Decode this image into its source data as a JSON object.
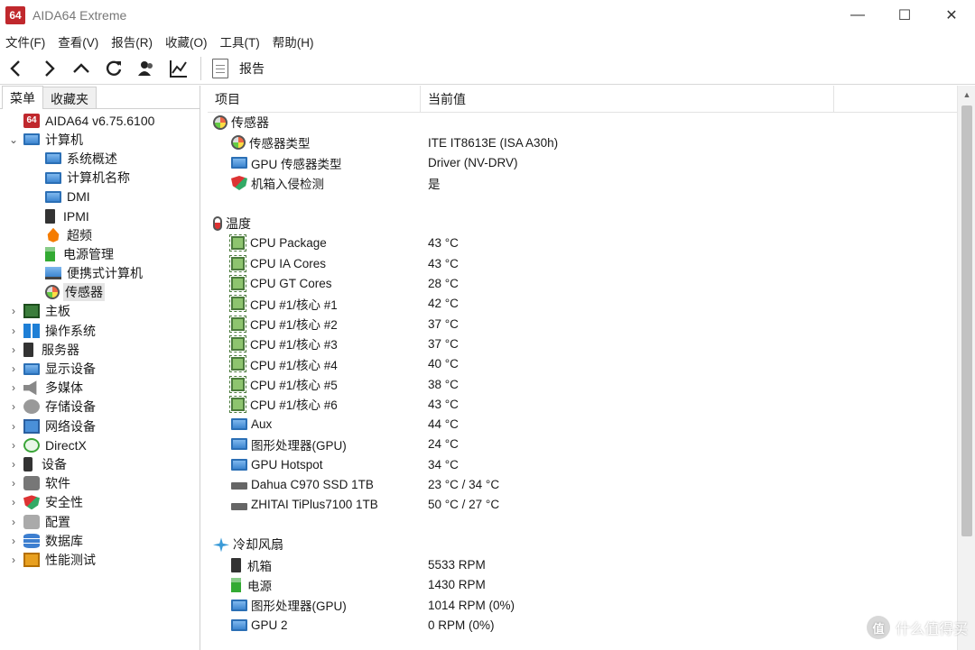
{
  "window": {
    "logo_text": "64",
    "title": "AIDA64 Extreme",
    "controls": {
      "minimize": "—",
      "maximize": "☐",
      "close": "✕"
    }
  },
  "menu": [
    "文件(F)",
    "查看(V)",
    "报告(R)",
    "收藏(O)",
    "工具(T)",
    "帮助(H)"
  ],
  "toolbar": {
    "report_label": "报告"
  },
  "left_panel": {
    "tabs": [
      "菜单",
      "收藏夹"
    ],
    "tree": [
      {
        "label": "AIDA64 v6.75.6100",
        "icon": "aida64-logo-icon",
        "level": 0,
        "chevron": ""
      },
      {
        "label": "计算机",
        "icon": "monitor-icon",
        "level": 0,
        "chevron": "⌄"
      },
      {
        "label": "系统概述",
        "icon": "monitor-icon",
        "level": 1,
        "chevron": ""
      },
      {
        "label": "计算机名称",
        "icon": "monitor-icon",
        "level": 1,
        "chevron": ""
      },
      {
        "label": "DMI",
        "icon": "monitor-icon",
        "level": 1,
        "chevron": ""
      },
      {
        "label": "IPMI",
        "icon": "tower-icon",
        "level": 1,
        "chevron": ""
      },
      {
        "label": "超频",
        "icon": "fire-icon",
        "level": 1,
        "chevron": ""
      },
      {
        "label": "电源管理",
        "icon": "power-icon",
        "level": 1,
        "chevron": ""
      },
      {
        "label": "便携式计算机",
        "icon": "laptop-icon",
        "level": 1,
        "chevron": ""
      },
      {
        "label": "传感器",
        "icon": "gauge-icon",
        "level": 1,
        "chevron": "",
        "selected": true
      },
      {
        "label": "主板",
        "icon": "motherboard-icon",
        "level": 0,
        "chevron": "›"
      },
      {
        "label": "操作系统",
        "icon": "windows-icon",
        "level": 0,
        "chevron": "›"
      },
      {
        "label": "服务器",
        "icon": "tower-icon",
        "level": 0,
        "chevron": "›"
      },
      {
        "label": "显示设备",
        "icon": "monitor-icon",
        "level": 0,
        "chevron": "›"
      },
      {
        "label": "多媒体",
        "icon": "speaker-icon",
        "level": 0,
        "chevron": "›"
      },
      {
        "label": "存储设备",
        "icon": "storage-icon",
        "level": 0,
        "chevron": "›"
      },
      {
        "label": "网络设备",
        "icon": "network-icon",
        "level": 0,
        "chevron": "›"
      },
      {
        "label": "DirectX",
        "icon": "directx-icon",
        "level": 0,
        "chevron": "›"
      },
      {
        "label": "设备",
        "icon": "device-icon",
        "level": 0,
        "chevron": "›"
      },
      {
        "label": "软件",
        "icon": "software-icon",
        "level": 0,
        "chevron": "›"
      },
      {
        "label": "安全性",
        "icon": "shield-icon",
        "level": 0,
        "chevron": "›"
      },
      {
        "label": "配置",
        "icon": "config-icon",
        "level": 0,
        "chevron": "›"
      },
      {
        "label": "数据库",
        "icon": "database-icon",
        "level": 0,
        "chevron": "›"
      },
      {
        "label": "性能测试",
        "icon": "benchmark-icon",
        "level": 0,
        "chevron": "›"
      }
    ]
  },
  "right_panel": {
    "columns": [
      "项目",
      "当前值"
    ],
    "sections": [
      {
        "title": "传感器",
        "icon": "gauge-icon",
        "items": [
          {
            "name": "传感器类型",
            "icon": "gauge-icon",
            "value": "ITE IT8613E  (ISA A30h)"
          },
          {
            "name": "GPU 传感器类型",
            "icon": "monitor-icon",
            "value": "Driver  (NV-DRV)"
          },
          {
            "name": "机箱入侵检测",
            "icon": "shield-icon",
            "value": "是"
          }
        ]
      },
      {
        "title": "温度",
        "icon": "thermometer-icon",
        "items": [
          {
            "name": "CPU Package",
            "icon": "chip-icon",
            "value": "43 °C"
          },
          {
            "name": "CPU IA Cores",
            "icon": "chip-icon",
            "value": "43 °C"
          },
          {
            "name": "CPU GT Cores",
            "icon": "chip-icon",
            "value": "28 °C"
          },
          {
            "name": "CPU #1/核心 #1",
            "icon": "chip-icon",
            "value": "42 °C"
          },
          {
            "name": "CPU #1/核心 #2",
            "icon": "chip-icon",
            "value": "37 °C"
          },
          {
            "name": "CPU #1/核心 #3",
            "icon": "chip-icon",
            "value": "37 °C"
          },
          {
            "name": "CPU #1/核心 #4",
            "icon": "chip-icon",
            "value": "40 °C"
          },
          {
            "name": "CPU #1/核心 #5",
            "icon": "chip-icon",
            "value": "38 °C"
          },
          {
            "name": "CPU #1/核心 #6",
            "icon": "chip-icon",
            "value": "43 °C"
          },
          {
            "name": "Aux",
            "icon": "monitor-icon",
            "value": "44 °C"
          },
          {
            "name": "图形处理器(GPU)",
            "icon": "monitor-icon",
            "value": "24 °C"
          },
          {
            "name": "GPU Hotspot",
            "icon": "monitor-icon",
            "value": "34 °C"
          },
          {
            "name": "Dahua C970 SSD 1TB",
            "icon": "disk-icon",
            "value": "23 °C / 34 °C"
          },
          {
            "name": "ZHITAI TiPlus7100 1TB",
            "icon": "disk-icon",
            "value": "50 °C / 27 °C"
          }
        ]
      },
      {
        "title": "冷却风扇",
        "icon": "fan-icon",
        "items": [
          {
            "name": "机箱",
            "icon": "tower-icon",
            "value": "5533 RPM"
          },
          {
            "name": "电源",
            "icon": "power-icon",
            "value": "1430 RPM"
          },
          {
            "name": "图形处理器(GPU)",
            "icon": "monitor-icon",
            "value": "1014 RPM  (0%)"
          },
          {
            "name": "GPU 2",
            "icon": "monitor-icon",
            "value": "0 RPM  (0%)"
          }
        ]
      }
    ]
  },
  "watermark": {
    "logo": "值",
    "text": "什么值得买"
  }
}
